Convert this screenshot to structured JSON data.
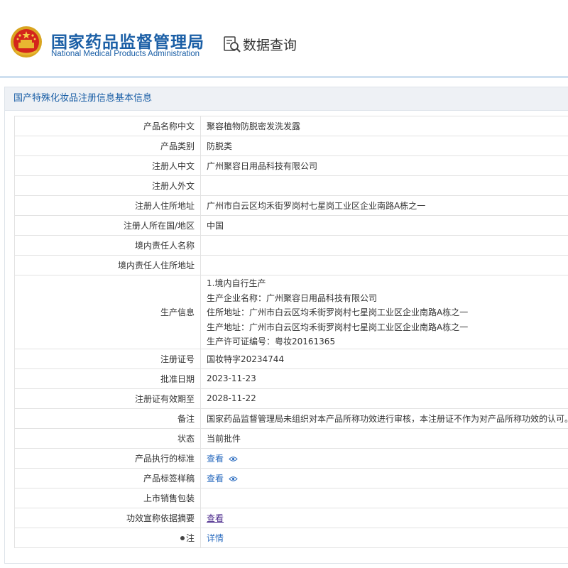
{
  "header": {
    "brand_cn": "国家药品监督管理局",
    "brand_en": "National Medical Products Administration",
    "query_title": "数据查询",
    "brand_color": "#1b5fa6"
  },
  "panel": {
    "title": "国产特殊化妆品注册信息基本信息"
  },
  "rows": [
    {
      "label": "产品名称中文",
      "value": "聚容植物防脱密发洗发露"
    },
    {
      "label": "产品类别",
      "value": "防脱类"
    },
    {
      "label": "注册人中文",
      "value": "广州聚容日用品科技有限公司"
    },
    {
      "label": "注册人外文",
      "value": ""
    },
    {
      "label": "注册人住所地址",
      "value": "广州市白云区均禾街罗岗村七星岗工业区企业南路A栋之一"
    },
    {
      "label": "注册人所在国/地区",
      "value": "中国"
    },
    {
      "label": "境内责任人名称",
      "value": ""
    },
    {
      "label": "境内责任人住所地址",
      "value": ""
    }
  ],
  "production": {
    "label": "生产信息",
    "lines": [
      "1.境内自行生产",
      "生产企业名称：广州聚容日用品科技有限公司",
      "住所地址：广州市白云区均禾街罗岗村七星岗工业区企业南路A栋之一",
      "生产地址：广州市白云区均禾街罗岗村七星岗工业区企业南路A栋之一",
      "生产许可证编号：粤妆20161365"
    ]
  },
  "rows2": [
    {
      "label": "注册证号",
      "value": "国妆特字20234744"
    },
    {
      "label": "批准日期",
      "value": "2023-11-23"
    },
    {
      "label": "注册证有效期至",
      "value": "2028-11-22"
    },
    {
      "label": "备注",
      "value": "国家药品监督管理局未组织对本产品所称功效进行审核，本注册证不作为对产品所称功效的认可。"
    },
    {
      "label": "状态",
      "value": "当前批件"
    }
  ],
  "links": {
    "standard_label": "产品执行的标准",
    "standard_link": "查看",
    "label_draft_label": "产品标签样稿",
    "label_draft_link": "查看",
    "packaging_label": "上市销售包装",
    "efficacy_label": "功效宣称依据摘要",
    "efficacy_link": "查看",
    "note_label": "注",
    "note_link": "详情"
  }
}
